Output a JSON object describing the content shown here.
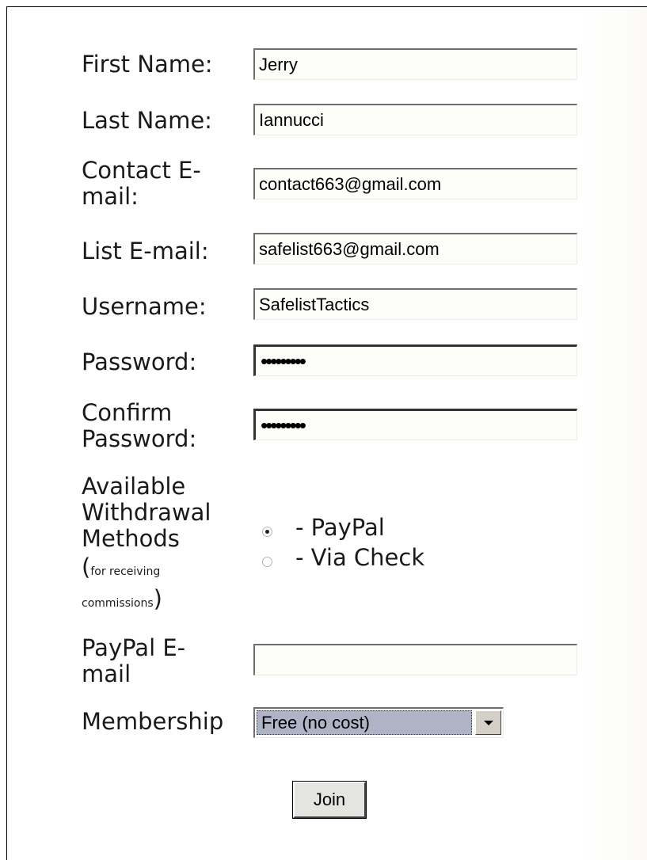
{
  "form": {
    "first_name": {
      "label": "First Name:",
      "value": "Jerry"
    },
    "last_name": {
      "label": "Last Name:",
      "value": "Iannucci"
    },
    "contact_email": {
      "label_line1": "Contact E-",
      "label_line2": "mail:",
      "value": "contact663@gmail.com"
    },
    "list_email": {
      "label": "List E-mail:",
      "value": "safelist663@gmail.com"
    },
    "username": {
      "label": "Username:",
      "value": "SafelistTactics"
    },
    "password": {
      "label": "Password:",
      "value": "•••••••••"
    },
    "confirm_password": {
      "label_line1": "Confirm",
      "label_line2": "Password:",
      "value": "•••••••••"
    },
    "withdrawal": {
      "label_line1": "Available",
      "label_line2": "Withdrawal",
      "label_line3": "Methods",
      "note_line1": "for receiving",
      "note_line2": "commissions",
      "options": [
        {
          "label": "- PayPal",
          "selected": true
        },
        {
          "label": "- Via Check",
          "selected": false
        }
      ]
    },
    "paypal_email": {
      "label_line1": "PayPal E-",
      "label_line2": "mail",
      "value": ""
    },
    "membership": {
      "label": "Membership",
      "selected": "Free (no cost)"
    },
    "submit_label": "Join"
  }
}
